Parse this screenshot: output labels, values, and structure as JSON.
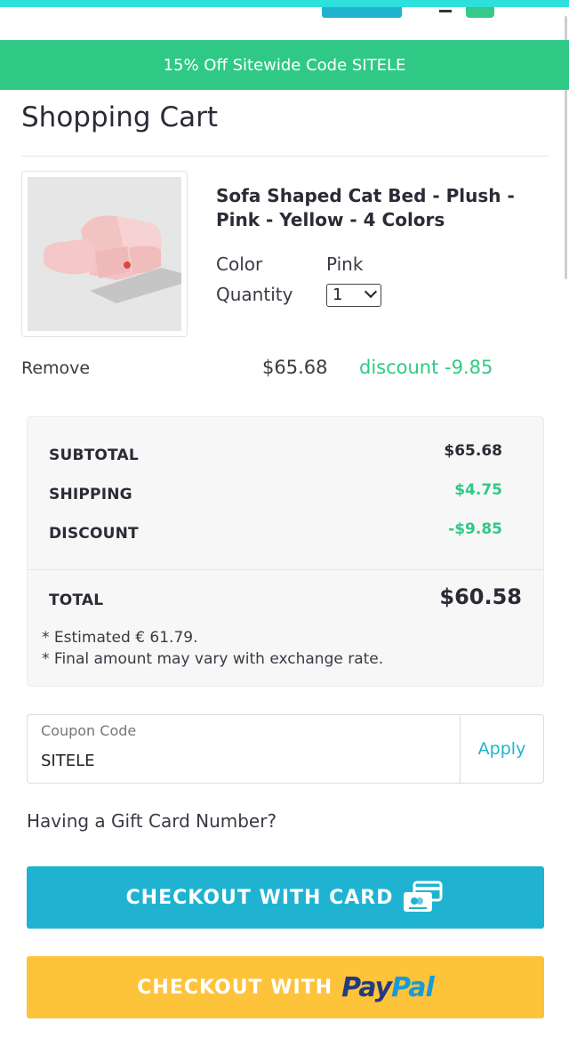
{
  "promo": {
    "text": "15% Off Sitewide Code SITELE"
  },
  "page": {
    "title": "Shopping Cart"
  },
  "item": {
    "title": "Sofa Shaped Cat Bed - Plush - Pink - Yellow - 4 Colors",
    "color_label": "Color",
    "color_value": "Pink",
    "quantity_label": "Quantity",
    "quantity_value": "1",
    "remove_label": "Remove",
    "price": "$65.68",
    "discount": "discount -9.85"
  },
  "summary": {
    "subtotal_label": "SUBTOTAL",
    "subtotal_value": "$65.68",
    "shipping_label": "SHIPPING",
    "shipping_value": "$4.75",
    "discount_label": "DISCOUNT",
    "discount_value": "-$9.85",
    "total_label": "TOTAL",
    "total_value": "$60.58",
    "note_estimate": "* Estimated € 61.79.",
    "note_rate": "* Final amount may vary with exchange rate."
  },
  "coupon": {
    "label": "Coupon Code",
    "value": "SITELE",
    "apply_label": "Apply"
  },
  "gift_card": {
    "text": "Having a Gift Card Number?"
  },
  "checkout": {
    "card_label": "CHECKOUT WITH CARD",
    "paypal_label": "CHECKOUT WITH",
    "paypal_logo_a": "Pay",
    "paypal_logo_b": "Pal"
  },
  "colors": {
    "accent_green": "#2fc985",
    "accent_blue": "#1fb3d1",
    "paypal_yellow": "#fdc33b",
    "text_dark": "#2b2b36"
  },
  "icons": {
    "checkout_card": "credit-card-icon",
    "quantity_dropdown": "chevron-down-icon"
  }
}
